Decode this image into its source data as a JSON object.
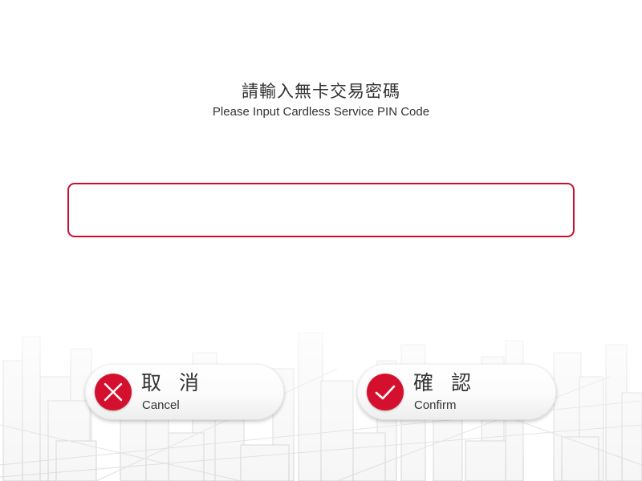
{
  "prompt": {
    "title_zh": "請輸入無卡交易密碼",
    "title_en": "Please Input Cardless Service PIN Code"
  },
  "pin_field": {
    "value": "",
    "placeholder": ""
  },
  "buttons": {
    "cancel": {
      "label_zh": "取 消",
      "label_en": "Cancel",
      "icon": "close-icon"
    },
    "confirm": {
      "label_zh": "確 認",
      "label_en": "Confirm",
      "icon": "checkmark-icon"
    }
  },
  "colors": {
    "accent": "#d5102e",
    "input_border": "#c8102e",
    "text": "#333333",
    "background": "#ffffff"
  }
}
